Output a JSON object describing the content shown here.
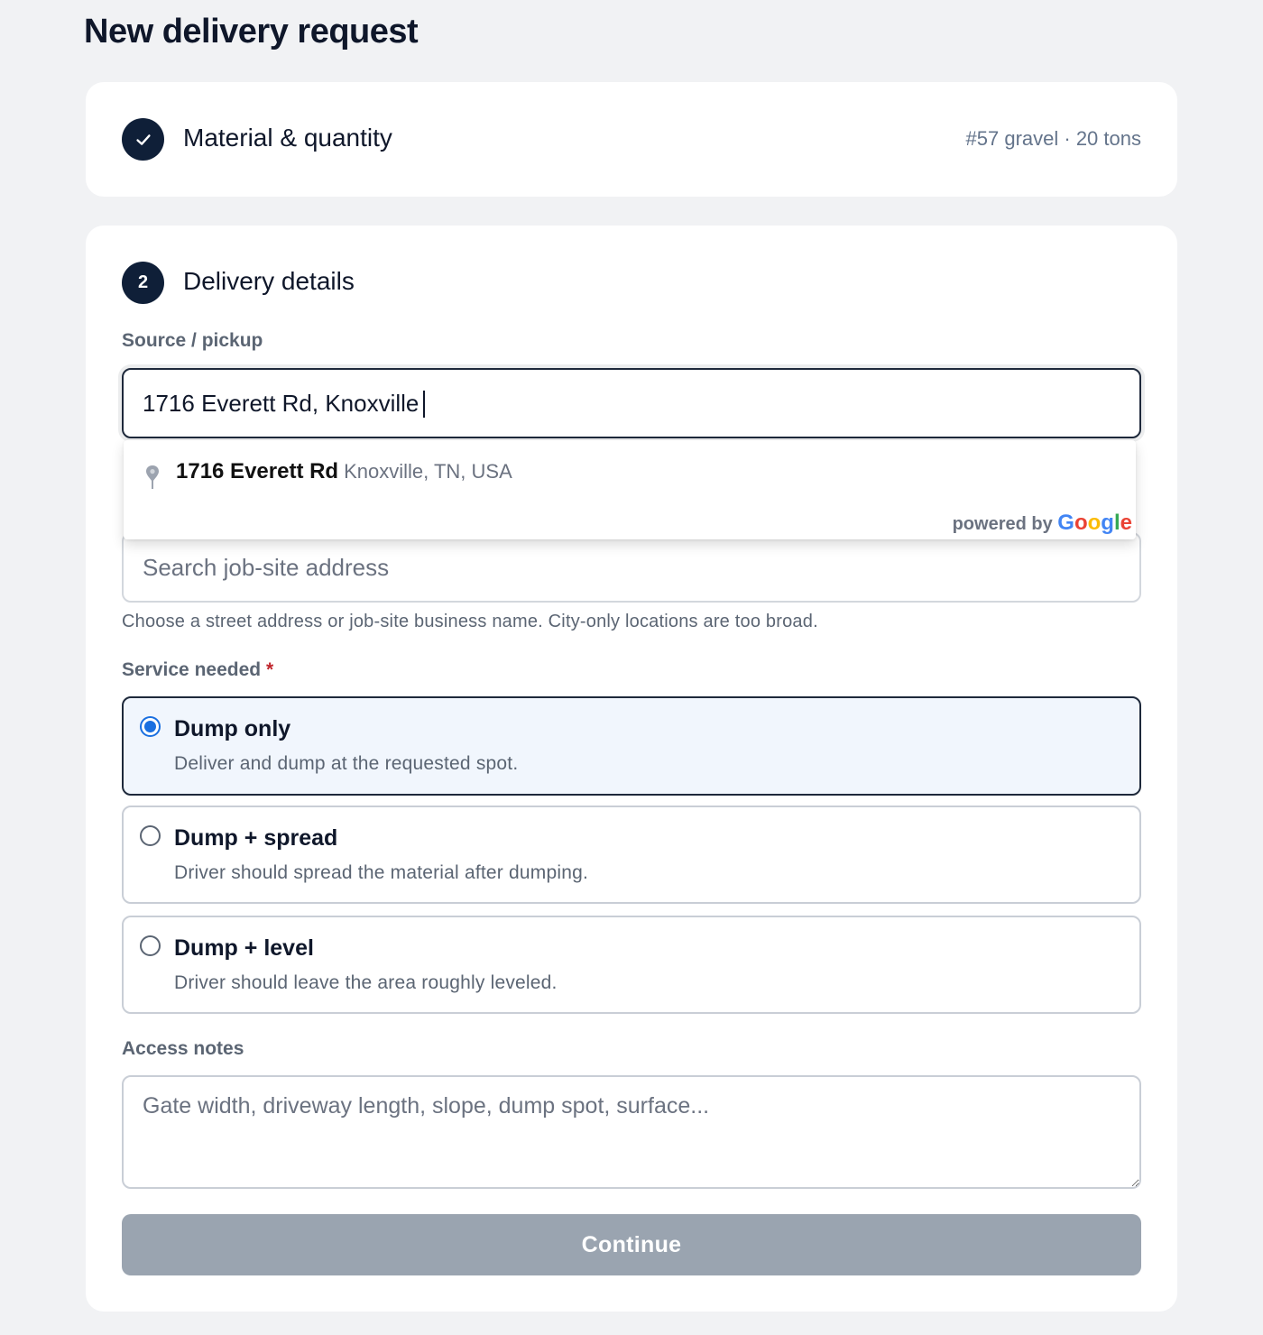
{
  "page": {
    "title": "New delivery request"
  },
  "step1": {
    "number_icon": "check-icon",
    "title": "Material & quantity",
    "summary": "#57 gravel · 20 tons"
  },
  "step2": {
    "number": "2",
    "title": "Delivery details",
    "source": {
      "label": "Source / pickup",
      "value": "1716 Everett Rd, Knoxville"
    },
    "autocomplete": {
      "suggestion_main": "1716 Everett Rd",
      "suggestion_secondary": "Knoxville, TN, USA",
      "powered_by": "powered by",
      "brand": "Google",
      "icon": "map-pin-icon"
    },
    "job_site": {
      "placeholder": "Search job-site address",
      "hint": "Choose a street address or job-site business name. City-only locations are too broad."
    },
    "service": {
      "label": "Service needed",
      "required_mark": "*",
      "options": [
        {
          "title": "Dump only",
          "description": "Deliver and dump at the requested spot.",
          "selected": true
        },
        {
          "title": "Dump + spread",
          "description": "Driver should spread the material after dumping.",
          "selected": false
        },
        {
          "title": "Dump + level",
          "description": "Driver should leave the area roughly leveled.",
          "selected": false
        }
      ]
    },
    "access_notes": {
      "label": "Access notes",
      "placeholder": "Gate width, driveway length, slope, dump spot, surface..."
    },
    "continue_label": "Continue"
  },
  "colors": {
    "accent": "#0f1f38",
    "radio_selected": "#1a6fe0",
    "button_disabled": "#9aa4b0",
    "required": "#c0262d",
    "google_blue": "#4285f4",
    "google_red": "#ea4335",
    "google_yellow": "#fbbc05",
    "google_green": "#34a853"
  }
}
